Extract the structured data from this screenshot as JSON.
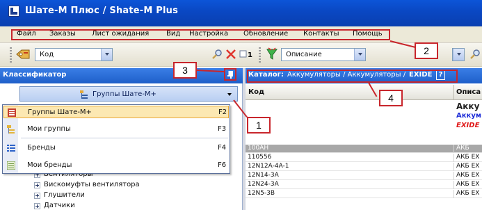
{
  "window": {
    "title": "Шате-М Плюс / Shate-M Plus"
  },
  "menu": {
    "items": [
      "Файл",
      "Заказы",
      "Лист ожидания",
      "Вид",
      "Настройка",
      "Обновление",
      "Контакты",
      "Помощь"
    ]
  },
  "toolbar": {
    "search_field": {
      "value": "Код"
    },
    "description_field": {
      "value": "Описание"
    }
  },
  "left_panel": {
    "title": "Классификатор",
    "groups_selector": {
      "value": "Группы Шате-М+"
    },
    "dropdown": [
      {
        "label": "Группы Шате-М+",
        "shortcut": "F2",
        "icon": "groups-tree-icon"
      },
      {
        "label": "Мои группы",
        "shortcut": "F3",
        "icon": "my-groups-icon"
      },
      {
        "label": "Бренды",
        "shortcut": "F4",
        "icon": "brands-list-icon"
      },
      {
        "label": "Мои бренды",
        "shortcut": "F6",
        "icon": "my-brands-icon"
      }
    ],
    "tree": [
      "Вентиляторы",
      "Вискомуфты вентилятора",
      "Глушители",
      "Датчики"
    ]
  },
  "catalog": {
    "prefix": "Каталог:",
    "path": "Аккумуляторы / Аккумуляторы /",
    "current": "EXIDE",
    "help": "?"
  },
  "grid": {
    "columns": [
      "Код",
      "Описа"
    ],
    "group_rows": [
      "Акку",
      "Аккум",
      "EXIDE"
    ],
    "rows": [
      {
        "code": "100AH",
        "desc": "АКБ",
        "selected": true
      },
      {
        "code": "110556",
        "desc": "АКБ EX",
        "selected": false
      },
      {
        "code": "12N12A-4A-1",
        "desc": "АКБ EX",
        "selected": false
      },
      {
        "code": "12N14-3A",
        "desc": "АКБ EX",
        "selected": false
      },
      {
        "code": "12N24-3A",
        "desc": "АКБ EX",
        "selected": false
      },
      {
        "code": "12N5-3B",
        "desc": "АКБ EX",
        "selected": false
      }
    ]
  },
  "callouts": [
    "1",
    "2",
    "3",
    "4"
  ],
  "colors": {
    "title_bar": "#0a47c2",
    "panel_header": "#1e5fc9",
    "callout_red": "#c8262c",
    "selected_item": "#fce8b2"
  }
}
